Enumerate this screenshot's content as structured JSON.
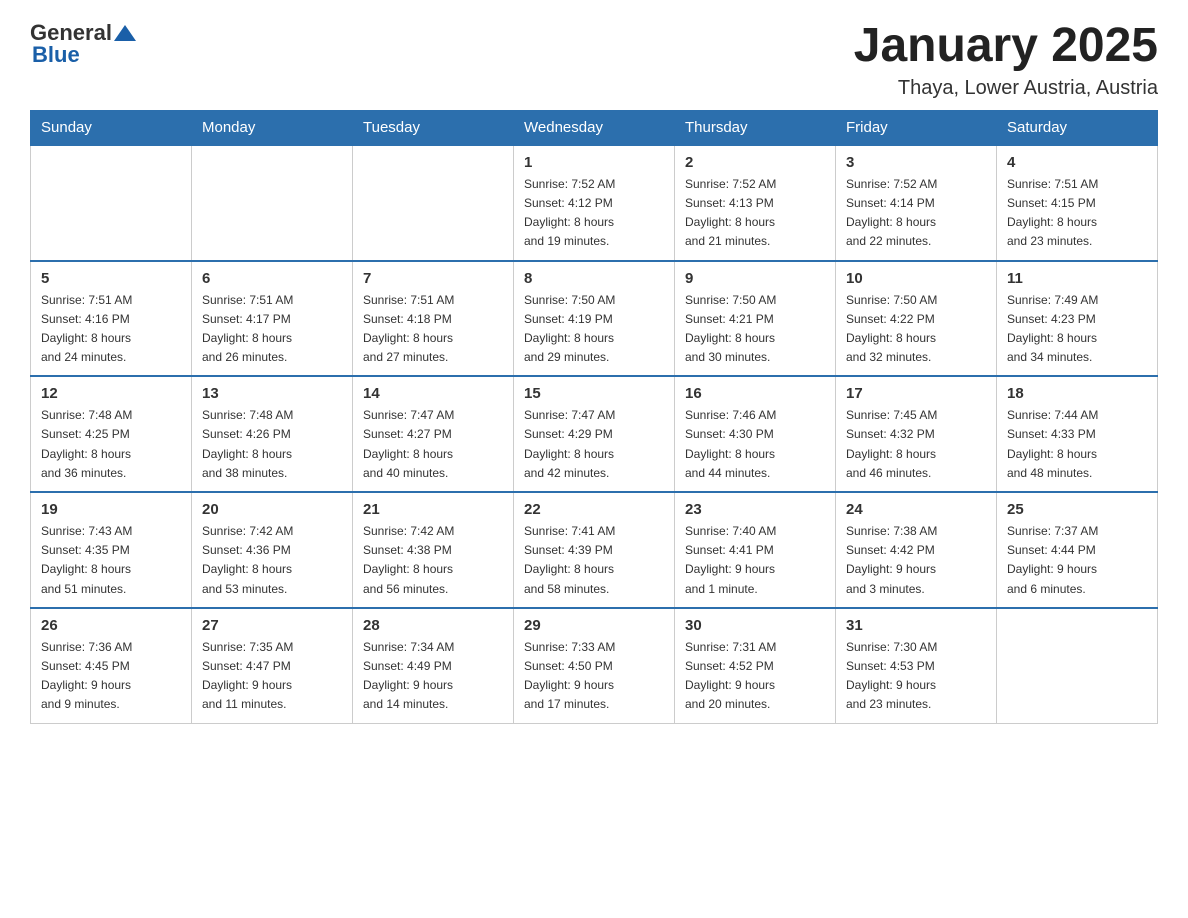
{
  "header": {
    "logo_general": "General",
    "logo_blue": "Blue",
    "title": "January 2025",
    "subtitle": "Thaya, Lower Austria, Austria"
  },
  "days_of_week": [
    "Sunday",
    "Monday",
    "Tuesday",
    "Wednesday",
    "Thursday",
    "Friday",
    "Saturday"
  ],
  "weeks": [
    [
      {
        "day": "",
        "info": ""
      },
      {
        "day": "",
        "info": ""
      },
      {
        "day": "",
        "info": ""
      },
      {
        "day": "1",
        "info": "Sunrise: 7:52 AM\nSunset: 4:12 PM\nDaylight: 8 hours\nand 19 minutes."
      },
      {
        "day": "2",
        "info": "Sunrise: 7:52 AM\nSunset: 4:13 PM\nDaylight: 8 hours\nand 21 minutes."
      },
      {
        "day": "3",
        "info": "Sunrise: 7:52 AM\nSunset: 4:14 PM\nDaylight: 8 hours\nand 22 minutes."
      },
      {
        "day": "4",
        "info": "Sunrise: 7:51 AM\nSunset: 4:15 PM\nDaylight: 8 hours\nand 23 minutes."
      }
    ],
    [
      {
        "day": "5",
        "info": "Sunrise: 7:51 AM\nSunset: 4:16 PM\nDaylight: 8 hours\nand 24 minutes."
      },
      {
        "day": "6",
        "info": "Sunrise: 7:51 AM\nSunset: 4:17 PM\nDaylight: 8 hours\nand 26 minutes."
      },
      {
        "day": "7",
        "info": "Sunrise: 7:51 AM\nSunset: 4:18 PM\nDaylight: 8 hours\nand 27 minutes."
      },
      {
        "day": "8",
        "info": "Sunrise: 7:50 AM\nSunset: 4:19 PM\nDaylight: 8 hours\nand 29 minutes."
      },
      {
        "day": "9",
        "info": "Sunrise: 7:50 AM\nSunset: 4:21 PM\nDaylight: 8 hours\nand 30 minutes."
      },
      {
        "day": "10",
        "info": "Sunrise: 7:50 AM\nSunset: 4:22 PM\nDaylight: 8 hours\nand 32 minutes."
      },
      {
        "day": "11",
        "info": "Sunrise: 7:49 AM\nSunset: 4:23 PM\nDaylight: 8 hours\nand 34 minutes."
      }
    ],
    [
      {
        "day": "12",
        "info": "Sunrise: 7:48 AM\nSunset: 4:25 PM\nDaylight: 8 hours\nand 36 minutes."
      },
      {
        "day": "13",
        "info": "Sunrise: 7:48 AM\nSunset: 4:26 PM\nDaylight: 8 hours\nand 38 minutes."
      },
      {
        "day": "14",
        "info": "Sunrise: 7:47 AM\nSunset: 4:27 PM\nDaylight: 8 hours\nand 40 minutes."
      },
      {
        "day": "15",
        "info": "Sunrise: 7:47 AM\nSunset: 4:29 PM\nDaylight: 8 hours\nand 42 minutes."
      },
      {
        "day": "16",
        "info": "Sunrise: 7:46 AM\nSunset: 4:30 PM\nDaylight: 8 hours\nand 44 minutes."
      },
      {
        "day": "17",
        "info": "Sunrise: 7:45 AM\nSunset: 4:32 PM\nDaylight: 8 hours\nand 46 minutes."
      },
      {
        "day": "18",
        "info": "Sunrise: 7:44 AM\nSunset: 4:33 PM\nDaylight: 8 hours\nand 48 minutes."
      }
    ],
    [
      {
        "day": "19",
        "info": "Sunrise: 7:43 AM\nSunset: 4:35 PM\nDaylight: 8 hours\nand 51 minutes."
      },
      {
        "day": "20",
        "info": "Sunrise: 7:42 AM\nSunset: 4:36 PM\nDaylight: 8 hours\nand 53 minutes."
      },
      {
        "day": "21",
        "info": "Sunrise: 7:42 AM\nSunset: 4:38 PM\nDaylight: 8 hours\nand 56 minutes."
      },
      {
        "day": "22",
        "info": "Sunrise: 7:41 AM\nSunset: 4:39 PM\nDaylight: 8 hours\nand 58 minutes."
      },
      {
        "day": "23",
        "info": "Sunrise: 7:40 AM\nSunset: 4:41 PM\nDaylight: 9 hours\nand 1 minute."
      },
      {
        "day": "24",
        "info": "Sunrise: 7:38 AM\nSunset: 4:42 PM\nDaylight: 9 hours\nand 3 minutes."
      },
      {
        "day": "25",
        "info": "Sunrise: 7:37 AM\nSunset: 4:44 PM\nDaylight: 9 hours\nand 6 minutes."
      }
    ],
    [
      {
        "day": "26",
        "info": "Sunrise: 7:36 AM\nSunset: 4:45 PM\nDaylight: 9 hours\nand 9 minutes."
      },
      {
        "day": "27",
        "info": "Sunrise: 7:35 AM\nSunset: 4:47 PM\nDaylight: 9 hours\nand 11 minutes."
      },
      {
        "day": "28",
        "info": "Sunrise: 7:34 AM\nSunset: 4:49 PM\nDaylight: 9 hours\nand 14 minutes."
      },
      {
        "day": "29",
        "info": "Sunrise: 7:33 AM\nSunset: 4:50 PM\nDaylight: 9 hours\nand 17 minutes."
      },
      {
        "day": "30",
        "info": "Sunrise: 7:31 AM\nSunset: 4:52 PM\nDaylight: 9 hours\nand 20 minutes."
      },
      {
        "day": "31",
        "info": "Sunrise: 7:30 AM\nSunset: 4:53 PM\nDaylight: 9 hours\nand 23 minutes."
      },
      {
        "day": "",
        "info": ""
      }
    ]
  ]
}
